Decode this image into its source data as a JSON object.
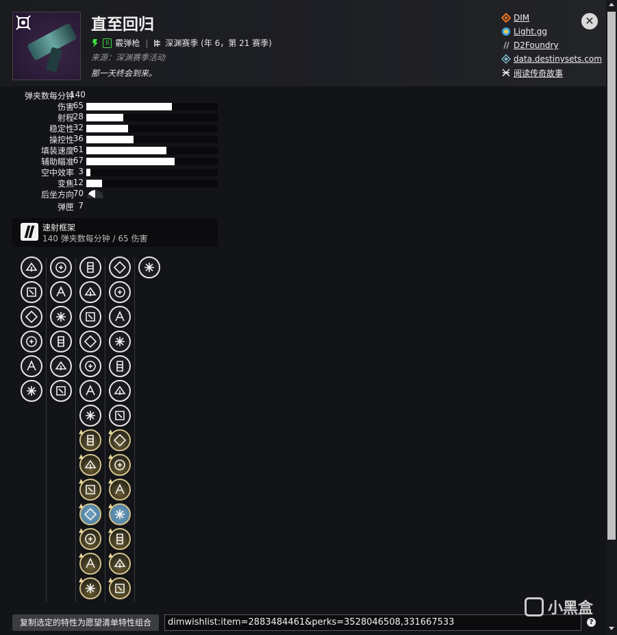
{
  "weapon": {
    "name": "直至回归",
    "ammo_badge": "II",
    "weapon_type": "霰弹枪",
    "season": "深渊赛季 (年 6，第 21 赛季)",
    "source": "来源：深渊赛季活动",
    "flavor": "那一天终会到来。"
  },
  "links": [
    {
      "label": "DIM",
      "icon": "dim-icon",
      "color": "#f37423"
    },
    {
      "label": "Light.gg",
      "icon": "lightgg-icon",
      "color": "#3fa7e0"
    },
    {
      "label": "D2Foundry",
      "icon": "d2foundry-icon",
      "color": "#aaaaaa"
    },
    {
      "label": "data.destinysets.com",
      "icon": "destinysets-icon",
      "color": "#7fb7c9"
    },
    {
      "label": "阅读传奇故事",
      "icon": "lore-icon",
      "color": "#eeeeee"
    }
  ],
  "stats": [
    {
      "label": "弹夹数每分钟",
      "value": "140",
      "bar": null
    },
    {
      "label": "伤害",
      "value": "65",
      "bar": 65
    },
    {
      "label": "射程",
      "value": "28",
      "bar": 28
    },
    {
      "label": "稳定性",
      "value": "32",
      "bar": 32
    },
    {
      "label": "操控性",
      "value": "36",
      "bar": 36
    },
    {
      "label": "填装速度",
      "value": "61",
      "bar": 61
    },
    {
      "label": "辅助瞄准",
      "value": "67",
      "bar": 67
    },
    {
      "label": "空中效率",
      "value": "3",
      "bar": 3
    },
    {
      "label": "变焦",
      "value": "12",
      "bar": 12
    },
    {
      "label": "后坐方向",
      "value": "70",
      "bar": null,
      "recoil": true
    },
    {
      "label": "弹匣",
      "value": "7",
      "bar": null
    }
  ],
  "frame": {
    "name": "速射框架",
    "description": "140 弹夹数每分钟 / 65 伤害"
  },
  "perk_columns": [
    {
      "icons": [
        "barrel-icon",
        "barrel-icon",
        "barrel-icon",
        "barrel-icon",
        "barrel-icon",
        "barrel-icon"
      ]
    },
    {
      "icons": [
        "magazine-icon",
        "magazine-icon",
        "magazine-icon",
        "magazine-icon",
        "magazine-icon",
        "magazine-icon"
      ]
    },
    {
      "icons": [
        "trait-icon",
        "trait-icon",
        "trait-icon",
        "trait-icon",
        "trait-icon",
        "trait-icon",
        "trait-icon",
        "trait-icon",
        "trait-icon",
        "trait-icon",
        "trait-icon",
        "trait-icon",
        "trait-icon",
        "trait-icon"
      ]
    },
    {
      "icons": [
        "trait-icon",
        "trait-icon",
        "trait-icon",
        "trait-icon",
        "trait-icon",
        "trait-icon",
        "trait-icon",
        "trait-icon",
        "trait-icon",
        "trait-icon",
        "trait-icon",
        "trait-icon",
        "trait-icon",
        "trait-icon"
      ]
    },
    {
      "icons": [
        "origin-trait-icon"
      ]
    }
  ],
  "actions": {
    "copy_button": "复制选定的特性为愿望清单特性组合",
    "wishlist_value": "dimwishlist:item=2883484461&perks=3528046508,331667533",
    "help": "?"
  },
  "watermark": "小黑盒"
}
